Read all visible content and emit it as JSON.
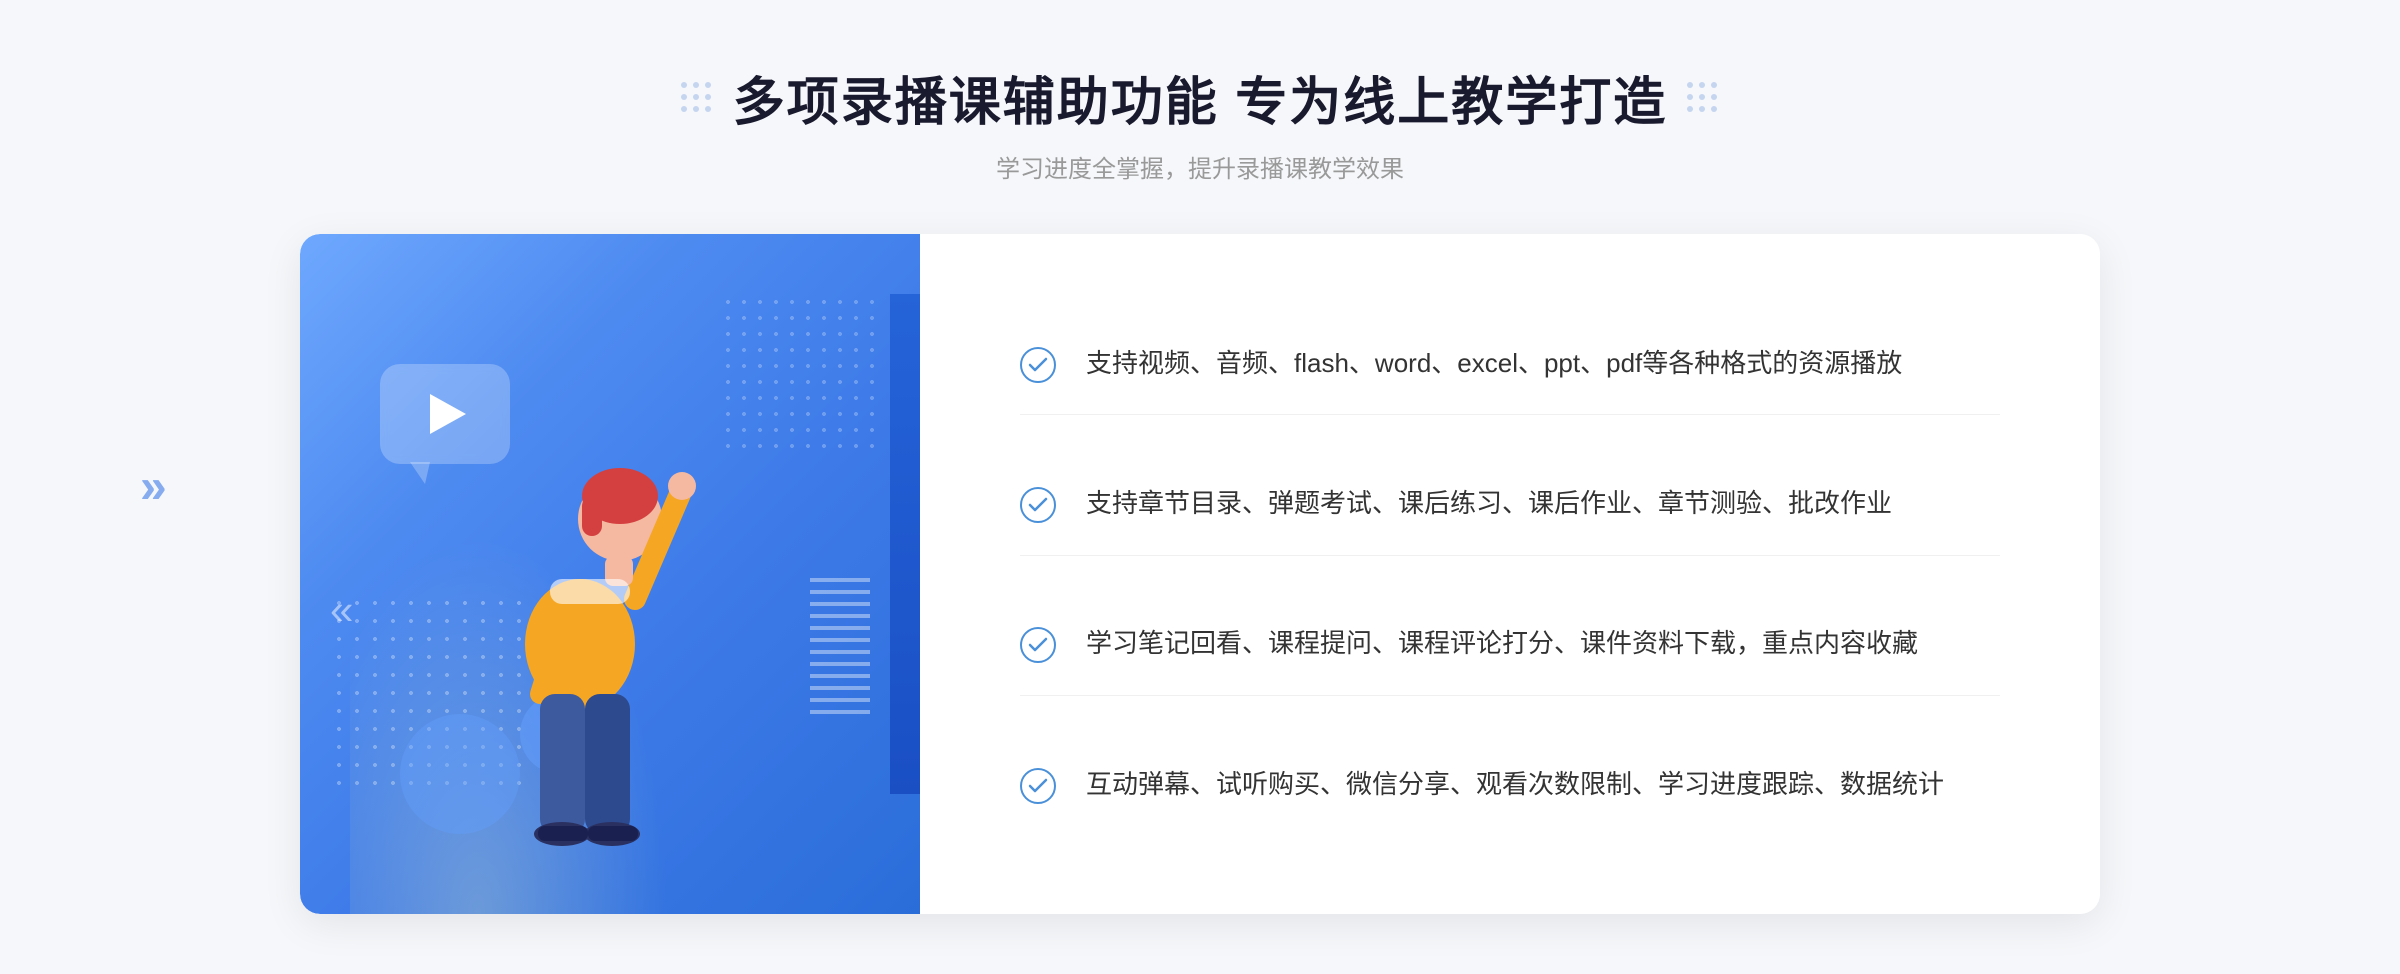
{
  "header": {
    "title": "多项录播课辅助功能 专为线上教学打造",
    "subtitle": "学习进度全掌握，提升录播课教学效果"
  },
  "decorations": {
    "dots_left": "⁚⁚",
    "dots_right": "⁚⁚",
    "chevron_outer": "»"
  },
  "features": [
    {
      "id": 1,
      "text": "支持视频、音频、flash、word、excel、ppt、pdf等各种格式的资源播放"
    },
    {
      "id": 2,
      "text": "支持章节目录、弹题考试、课后练习、课后作业、章节测验、批改作业"
    },
    {
      "id": 3,
      "text": "学习笔记回看、课程提问、课程评论打分、课件资料下载，重点内容收藏"
    },
    {
      "id": 4,
      "text": "互动弹幕、试听购买、微信分享、观看次数限制、学习进度跟踪、数据统计"
    }
  ],
  "colors": {
    "primary_blue": "#3d7ae8",
    "light_blue": "#6ea8fe",
    "dark_blue": "#2a6dd9",
    "text_dark": "#333333",
    "text_gray": "#999999",
    "check_color": "#4a90d9"
  }
}
